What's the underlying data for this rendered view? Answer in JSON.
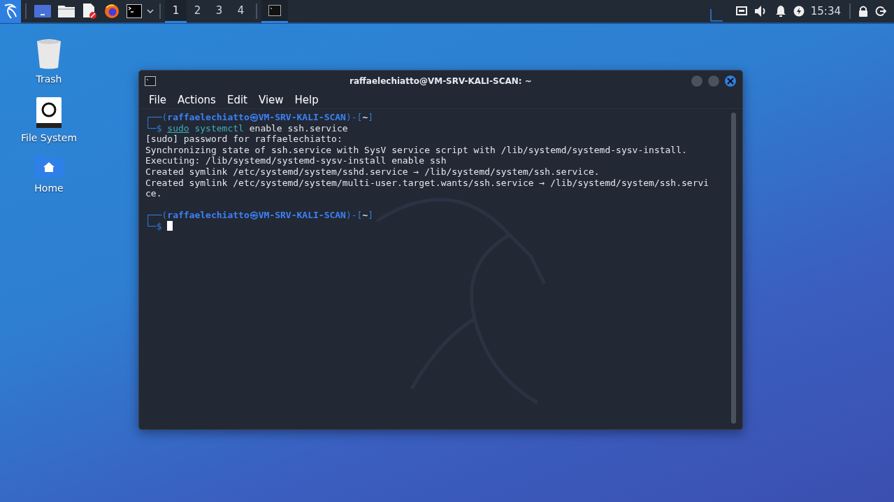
{
  "taskbar": {
    "workspaces": [
      {
        "label": "1",
        "selected": true
      },
      {
        "label": "2",
        "selected": false
      },
      {
        "label": "3",
        "selected": false
      },
      {
        "label": "4",
        "selected": false
      }
    ],
    "window_buttons": [
      {
        "selected": true
      }
    ],
    "clock": "15:34"
  },
  "desktop_icons": [
    {
      "label": "Trash",
      "kind": "trash"
    },
    {
      "label": "File System",
      "kind": "drive"
    },
    {
      "label": "Home",
      "kind": "home"
    }
  ],
  "terminal": {
    "title": "raffaelechiatto@VM-SRV-KALI-SCAN: ~",
    "menu": [
      "File",
      "Actions",
      "Edit",
      "View",
      "Help"
    ],
    "blocks": [
      {
        "lines": [
          {
            "segments": [
              {
                "text": "┌──(",
                "kind": "frame"
              },
              {
                "text": "raffaelechiatto㉿VM-SRV-KALI-SCAN",
                "kind": "user"
              },
              {
                "text": ")-[",
                "kind": "frame"
              },
              {
                "text": "~",
                "kind": "path"
              },
              {
                "text": "]",
                "kind": "frame"
              }
            ]
          },
          {
            "segments": [
              {
                "text": "└─$ ",
                "kind": "frame"
              },
              {
                "text": "sudo",
                "kind": "sudo"
              },
              {
                "text": " systemctl",
                "kind": "command"
              },
              {
                "text": " enable ssh.service",
                "kind": "plain"
              }
            ]
          },
          {
            "segments": [
              {
                "text": "[sudo] password for raffaelechiatto:",
                "kind": "plain"
              }
            ]
          },
          {
            "segments": [
              {
                "text": "Synchronizing state of ssh.service with SysV service script with /lib/systemd/systemd-sysv-install.",
                "kind": "plain"
              }
            ]
          },
          {
            "segments": [
              {
                "text": "Executing: /lib/systemd/systemd-sysv-install enable ssh",
                "kind": "plain"
              }
            ]
          },
          {
            "segments": [
              {
                "text": "Created symlink /etc/systemd/system/sshd.service → /lib/systemd/system/ssh.service.",
                "kind": "plain"
              }
            ]
          },
          {
            "segments": [
              {
                "text": "Created symlink /etc/systemd/system/multi-user.target.wants/ssh.service → /lib/systemd/system/ssh.servi",
                "kind": "plain"
              }
            ]
          },
          {
            "segments": [
              {
                "text": "ce.",
                "kind": "plain"
              }
            ]
          }
        ]
      },
      {
        "lines": [
          {
            "segments": [
              {
                "text": "┌──(",
                "kind": "frame"
              },
              {
                "text": "raffaelechiatto㉿VM-SRV-KALI-SCAN",
                "kind": "user"
              },
              {
                "text": ")-[",
                "kind": "frame"
              },
              {
                "text": "~",
                "kind": "path"
              },
              {
                "text": "]",
                "kind": "frame"
              }
            ]
          },
          {
            "segments": [
              {
                "text": "└─$ ",
                "kind": "frame"
              },
              {
                "kind": "cursor"
              }
            ]
          }
        ]
      }
    ]
  }
}
